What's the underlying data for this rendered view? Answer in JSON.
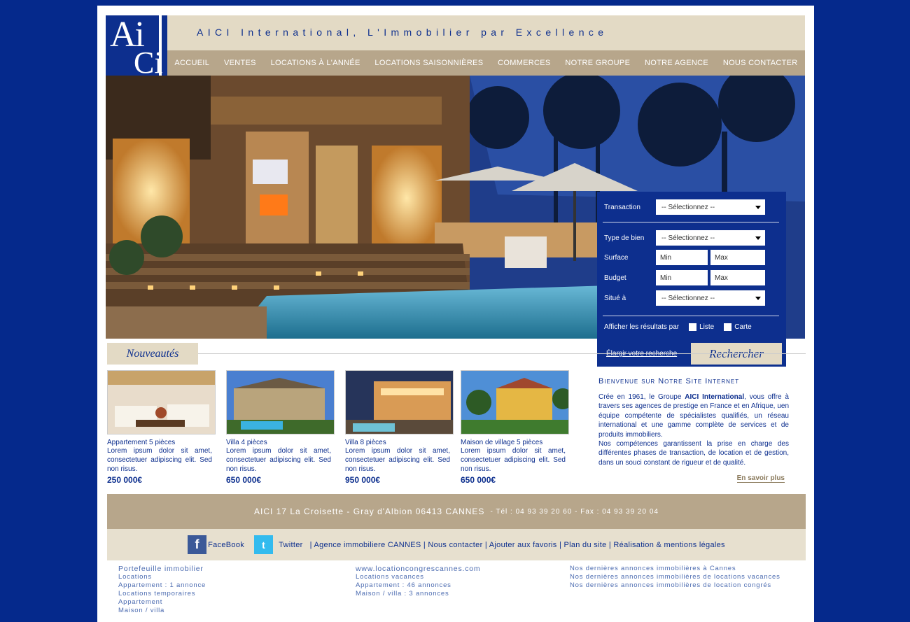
{
  "header": {
    "logo_top": "Ai",
    "logo_bottom": "Ci",
    "tagline": "AICI International, L'Immobilier par Excellence"
  },
  "nav": [
    "ACCUEIL",
    "VENTES",
    "LOCATIONS À L'ANNÉE",
    "LOCATIONS SAISONNIÈRES",
    "COMMERCES",
    "NOTRE GROUPE",
    "NOTRE AGENCE",
    "NOUS CONTACTER"
  ],
  "search": {
    "transaction_label": "Transaction",
    "transaction_value": "-- Sélectionnez --",
    "type_label": "Type de bien",
    "type_value": "-- Sélectionnez --",
    "surface_label": "Surface",
    "budget_label": "Budget",
    "min": "Min",
    "max": "Max",
    "situe_label": "Situé à",
    "situe_value": "-- Sélectionnez --",
    "afficher_label": "Afficher les résultats par",
    "liste": "Liste",
    "carte": "Carte",
    "elargir": "Élargir votre recherche",
    "rechercher": "Rechercher"
  },
  "nouveautes": "Nouveautés",
  "listings": [
    {
      "title": "Appartement 5 pièces",
      "desc": "Lorem ipsum dolor sit amet, consectetuer adipiscing elit. Sed non risus.",
      "price": "250 000€"
    },
    {
      "title": "Villa 4 pièces",
      "desc": "Lorem ipsum dolor sit amet, consectetuer adipiscing elit. Sed non risus.",
      "price": "650 000€"
    },
    {
      "title": "Villa 8 pièces",
      "desc": "Lorem ipsum dolor sit amet, consectetuer adipiscing elit. Sed non risus.",
      "price": "950 000€"
    },
    {
      "title": "Maison de village 5 pièces",
      "desc": "Lorem ipsum dolor sit amet, consectetuer adipiscing elit. Sed non risus.",
      "price": "650 000€"
    }
  ],
  "welcome": {
    "heading": "Bienvenue sur Notre Site Internet",
    "p1_a": " Crée en 1961, le Groupe ",
    "p1_b": "AICI International",
    "p1_c": ", vous offre à travers ses agences de prestige en France et en Afrique, uen équipe compétente de spécialistes qualifiés, un réseau international et une gamme complète de services et de produits immobiliers.",
    "p2": "Nos compétences garantissent la prise en charge des différentes phases de transaction, de location et de gestion, dans un souci constant de rigueur et de qualité.",
    "more": "En savoir plus"
  },
  "address": {
    "main": "AICI 17 La Croisette - Gray d'Albion 06413 CANNES",
    "tel": "- Tél : 04 93 39 20 60 - Fax : 04 93 39 20 04"
  },
  "social": {
    "facebook": "FaceBook",
    "twitter": "Twitter",
    "links": "| Agence immobiliere CANNES | Nous contacter | Ajouter aux favoris | Plan du site | Réalisation & mentions légales"
  },
  "footer": {
    "col1": [
      "Portefeuille immobilier",
      "Locations",
      "Appartement : 1 annonce",
      "Locations temporaires",
      "Appartement",
      "Maison / villa"
    ],
    "col2": [
      "www.locationcongrescannes.com",
      "Locations vacances",
      "Appartement : 46 annonces",
      "Maison / villa : 3 annonces"
    ],
    "col3": [
      "Nos dernières annonces immobilières à Cannes",
      "Nos dernières annonces immobilières de locations vacances",
      "Nos dernières annonces immobilières de location congrés"
    ]
  }
}
